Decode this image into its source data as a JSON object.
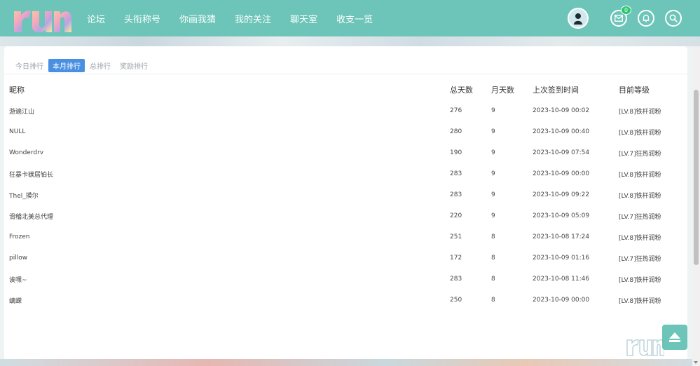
{
  "nav": {
    "links": [
      "论坛",
      "头衔称号",
      "你画我猜",
      "我的关注",
      "聊天室",
      "收支一览"
    ],
    "mail_badge": "0",
    "accent": "#6cc5b8"
  },
  "tabs": [
    {
      "label": "今日排行",
      "active": false
    },
    {
      "label": "本月排行",
      "active": true
    },
    {
      "label": "总排行",
      "active": false
    },
    {
      "label": "奖励排行",
      "active": false
    }
  ],
  "table": {
    "headers": [
      "昵称",
      "总天数",
      "月天数",
      "上次签到时间",
      "目前等级"
    ],
    "rows": [
      [
        "游遍江山",
        "276",
        "9",
        "2023-10-09 00:02",
        "[LV.8]铁杆润粉"
      ],
      [
        "NULL",
        "280",
        "9",
        "2023-10-09 00:40",
        "[LV.8]铁杆润粉"
      ],
      [
        "Wonderdrv",
        "190",
        "9",
        "2023-10-09 07:54",
        "[LV.7]狂热润粉"
      ],
      [
        "狂暴卡碳居铂长",
        "283",
        "9",
        "2023-10-09 00:00",
        "[LV.8]铁杆润粉"
      ],
      [
        "Thel_摸尔",
        "283",
        "9",
        "2023-10-09 09:22",
        "[LV.8]铁杆润粉"
      ],
      [
        "滑稽北美总代理",
        "220",
        "9",
        "2023-10-09 05:09",
        "[LV.7]狂热润粉"
      ],
      [
        "Frozen",
        "251",
        "8",
        "2023-10-08 17:24",
        "[LV.8]铁杆润粉"
      ],
      [
        "pillow",
        "172",
        "8",
        "2023-10-09 01:16",
        "[LV.7]狂热润粉"
      ],
      [
        "诶嘿~",
        "283",
        "8",
        "2023-10-08 11:46",
        "[LV.8]铁杆润粉"
      ],
      [
        "螭蝾",
        "250",
        "8",
        "2023-10-09 00:00",
        "[LV.8]铁杆润粉"
      ]
    ]
  },
  "icons": {
    "mail": "mail-icon",
    "bell": "bell-icon",
    "search": "search-icon",
    "back_to_top": "eject-icon"
  }
}
